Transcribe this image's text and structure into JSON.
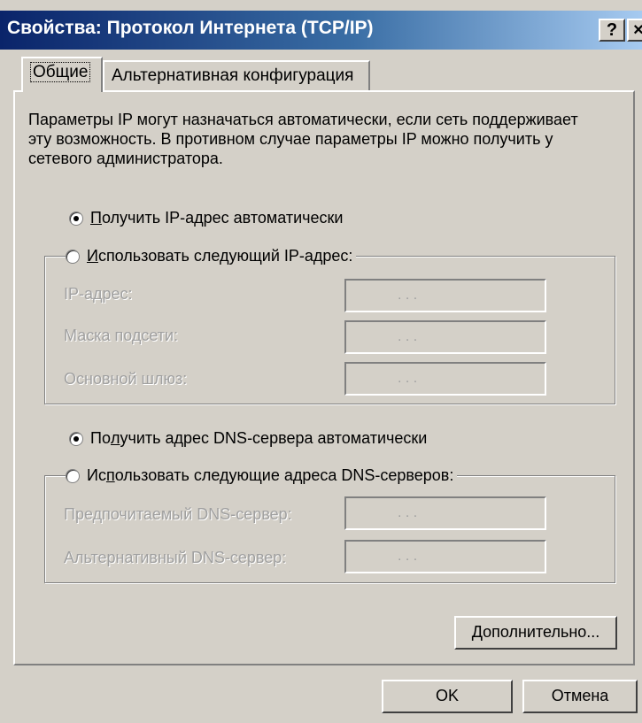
{
  "window": {
    "title": "Свойства: Протокол Интернета (TCP/IP)",
    "help_label": "?",
    "close_label": "×"
  },
  "tabs": [
    {
      "label": "Общие",
      "selected": true
    },
    {
      "label": "Альтернативная конфигурация",
      "selected": false
    }
  ],
  "description": "Параметры IP могут назначаться автоматически, если сеть поддерживает эту возможность. В противном случае параметры IP можно получить у сетевого администратора.",
  "ip_section": {
    "auto_label_prefix": "П",
    "auto_label_rest": "олучить IP-адрес автоматически",
    "auto_selected": true,
    "manual_label_prefix": "И",
    "manual_label_rest": "спользовать следующий IP-адрес:",
    "manual_selected": false,
    "fields": [
      {
        "label": "IP-адрес:",
        "value": ".      .      ."
      },
      {
        "label": "Маска подсети:",
        "value": ".      .      ."
      },
      {
        "label": "Основной шлюз:",
        "value": ".      .      ."
      }
    ]
  },
  "dns_section": {
    "auto_label_prefix": "По",
    "auto_label_u": "л",
    "auto_label_rest": "учить адрес DNS-сервера автоматически",
    "auto_selected": true,
    "manual_label_prefix": "Ис",
    "manual_label_u": "п",
    "manual_label_rest": "ользовать следующие адреса DNS-серверов:",
    "manual_selected": false,
    "fields": [
      {
        "label": "Предпочитаемый DNS-сервер:",
        "value": ".      .      ."
      },
      {
        "label": "Альтернативный DNS-сервер:",
        "value": ".      .      ."
      }
    ]
  },
  "buttons": {
    "advanced": "Дополнительно...",
    "ok": "OK",
    "cancel": "Отмена"
  },
  "colors": {
    "face": "#d4d0c8",
    "title_start": "#0a246a",
    "title_end": "#a6caf0",
    "disabled_text": "#a0a0a0"
  }
}
